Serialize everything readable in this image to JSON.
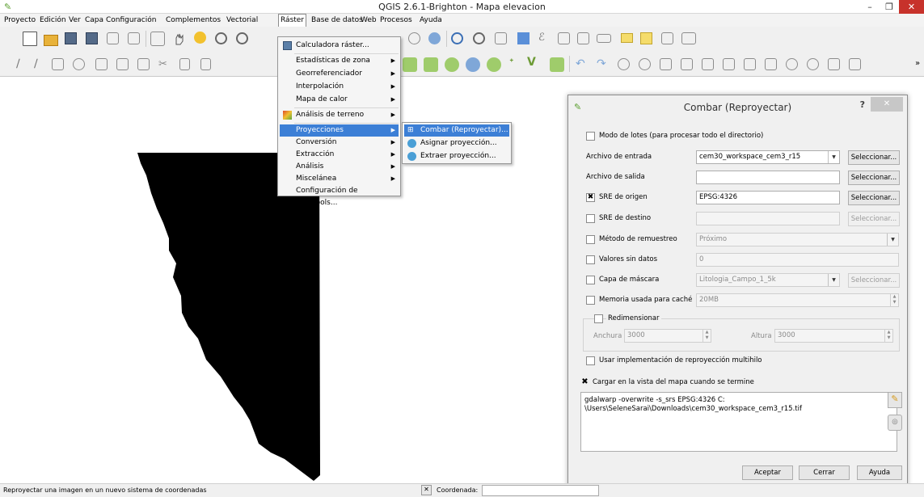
{
  "window": {
    "title": "QGIS 2.6.1-Brighton - Mapa elevacion",
    "min": "–",
    "max": "❐",
    "close": "✕"
  },
  "menubar": [
    "Proyecto",
    "Edición",
    "Ver",
    "Capa",
    "Configuración",
    "Complementos",
    "Vectorial",
    "Ráster",
    "Base de datos",
    "Web",
    "Procesos",
    "Ayuda"
  ],
  "raster_menu": [
    {
      "label": "Calculadora ráster...",
      "submenu": false
    },
    {
      "label": "Estadísticas de zona",
      "submenu": true
    },
    {
      "label": "Georreferenciador",
      "submenu": true
    },
    {
      "label": "Interpolación",
      "submenu": true
    },
    {
      "label": "Mapa de calor",
      "submenu": true
    },
    {
      "label": "Análisis de terreno",
      "submenu": true
    },
    {
      "label": "Proyecciones",
      "submenu": true
    },
    {
      "label": "Conversión",
      "submenu": true
    },
    {
      "label": "Extracción",
      "submenu": true
    },
    {
      "label": "Análisis",
      "submenu": true
    },
    {
      "label": "Miscelánea",
      "submenu": true
    },
    {
      "label": "Configuración de GdalTools...",
      "submenu": false
    }
  ],
  "projections_submenu": [
    "Combar (Reproyectar)...",
    "Asignar proyección...",
    "Extraer proyección..."
  ],
  "dialog": {
    "title": "Combar (Reproyectar)",
    "help": "?",
    "close": "✕",
    "batch_mode": "Modo de lotes (para procesar todo el directorio)",
    "input_label": "Archivo de entrada",
    "input_value": "cem30_workspace_cem3_r15",
    "output_label": "Archivo de salida",
    "output_value": "",
    "source_srs_label": "SRE de origen",
    "source_srs_value": "EPSG:4326",
    "source_srs_checked": "✖",
    "target_srs_label": "SRE de destino",
    "target_srs_value": "",
    "resampling_label": "Método de remuestreo",
    "resampling_value": "Próximo",
    "nodata_label": "Valores sin datos",
    "nodata_value": "0",
    "mask_label": "Capa de máscara",
    "mask_value": "Litologia_Campo_1_5k",
    "cache_label": "Memoria usada para caché",
    "cache_value": "20MB",
    "resize_label": "Redimensionar",
    "width_label": "Anchura",
    "width_value": "3000",
    "height_label": "Altura",
    "height_value": "3000",
    "multithread_label": "Usar implementación de reproyección multihilo",
    "load_label": "Cargar en la vista del mapa cuando se termine",
    "load_checked": "✖",
    "command_line1": "gdalwarp -overwrite -s_srs EPSG:4326 C:",
    "command_line2": "\\Users\\SeleneSarai\\Downloads\\cem30_workspace_cem3_r15.tif",
    "select_label": "Seleccionar...",
    "accept": "Aceptar",
    "close_btn": "Cerrar",
    "help_btn": "Ayuda"
  },
  "statusbar": {
    "text": "Reproyectar una imagen en un nuevo sistema de coordenadas",
    "coord_label": "Coordenada:"
  },
  "colors": {
    "highlight": "#3c7fd6",
    "raster": "#000000"
  }
}
